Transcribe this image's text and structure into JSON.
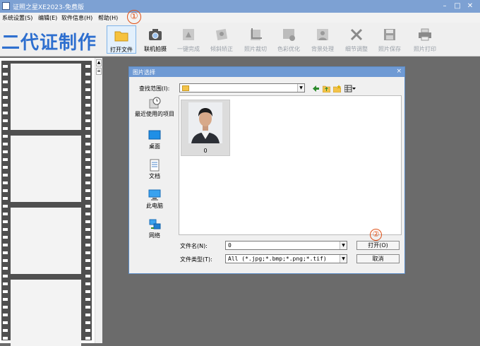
{
  "window": {
    "title": "证照之星XE2023-免费版",
    "min_icon": "minimize-icon",
    "max_icon": "maximize-icon",
    "close_icon": "close-icon"
  },
  "menu": [
    {
      "label": "系统设置(S)"
    },
    {
      "label": "编辑(E)"
    },
    {
      "label": "软件信息(H)"
    },
    {
      "label": "帮助(H)"
    }
  ],
  "brand": "二代证制作",
  "toolbar": {
    "buttons": [
      {
        "label": "打开文件",
        "icon": "folder-icon",
        "state": "active"
      },
      {
        "label": "联机拍摄",
        "icon": "camera-icon",
        "state": "enabled"
      },
      {
        "label": "一键完成",
        "icon": "one-click-icon",
        "state": "disabled"
      },
      {
        "label": "倾斜矫正",
        "icon": "tilt-correct-icon",
        "state": "disabled"
      },
      {
        "label": "照片裁切",
        "icon": "crop-icon",
        "state": "disabled"
      },
      {
        "label": "色彩优化",
        "icon": "color-optimize-icon",
        "state": "disabled"
      },
      {
        "label": "背景处理",
        "icon": "background-icon",
        "state": "disabled"
      },
      {
        "label": "细节调整",
        "icon": "tools-icon",
        "state": "disabled"
      },
      {
        "label": "照片保存",
        "icon": "save-icon",
        "state": "disabled"
      },
      {
        "label": "照片打印",
        "icon": "printer-icon",
        "state": "disabled"
      }
    ],
    "step1_marker": "①"
  },
  "dialog": {
    "title": "图片选择",
    "close": "×",
    "look_in_label": "查找范围(I):",
    "look_in_value": "",
    "nav_icons": [
      "back-arrow-icon",
      "up-folder-icon",
      "new-folder-icon",
      "view-menu-icon"
    ],
    "places": [
      {
        "label": "最近使用的项目",
        "icon": "recent-items-icon"
      },
      {
        "label": "桌面",
        "icon": "desktop-icon"
      },
      {
        "label": "文档",
        "icon": "documents-icon"
      },
      {
        "label": "此电脑",
        "icon": "this-pc-icon"
      },
      {
        "label": "网络",
        "icon": "network-icon"
      }
    ],
    "files": [
      {
        "name": "0"
      }
    ],
    "filename_label": "文件名(N):",
    "filename_value": "0",
    "filetype_label": "文件类型(T):",
    "filetype_value": "All (*.jpg;*.bmp;*.png;*.tif)",
    "open_label": "打开(O)",
    "cancel_label": "取消",
    "step2_marker": "②"
  },
  "colors": {
    "accent": "#2e6fcf",
    "titlebar": "#7da1d3",
    "dialog_title": "#6f9ad4",
    "marker": "#e05016"
  }
}
